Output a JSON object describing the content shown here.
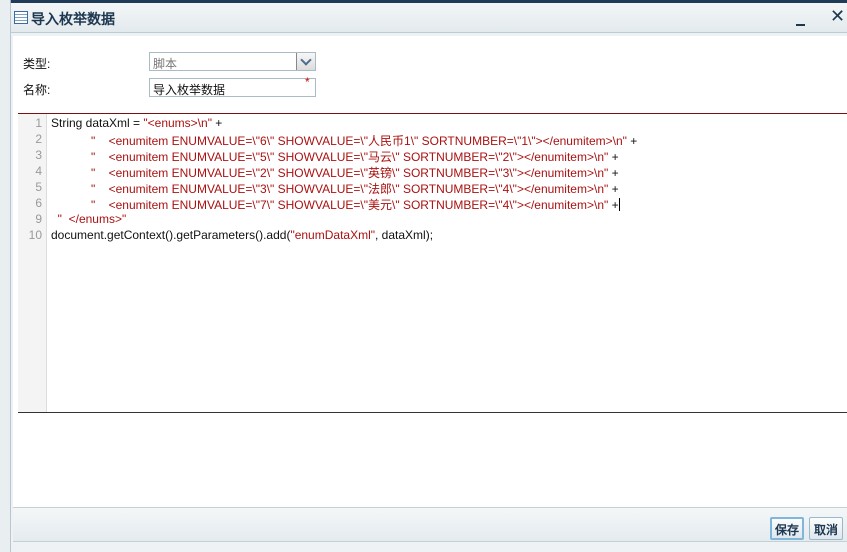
{
  "dialog": {
    "title": "导入枚举数据",
    "minimize_label": "_",
    "close_label": "✕"
  },
  "form": {
    "type_label": "类型:",
    "type_value": "脚本",
    "name_label": "名称:",
    "name_value": "导入枚举数据",
    "required_mark": "*"
  },
  "editor": {
    "line_numbers": [
      "1",
      "2",
      "3",
      "4",
      "5",
      "6",
      "9",
      "10"
    ],
    "lines": [
      [
        {
          "t": "String dataXml = ",
          "c": "p"
        },
        {
          "t": "\"<enums>\\n\"",
          "c": "s"
        },
        {
          "t": " +",
          "c": "p"
        }
      ],
      [
        {
          "t": "            \"    <enumitem ENUMVALUE=\\\"6\\\" SHOWVALUE=\\\"人民币1\\\" SORTNUMBER=\\\"1\\\"></enumitem>\\n\"",
          "c": "s"
        },
        {
          "t": " +",
          "c": "p"
        }
      ],
      [
        {
          "t": "            \"    <enumitem ENUMVALUE=\\\"5\\\" SHOWVALUE=\\\"马云\\\" SORTNUMBER=\\\"2\\\"></enumitem>\\n\"",
          "c": "s"
        },
        {
          "t": " +",
          "c": "p"
        }
      ],
      [
        {
          "t": "            \"    <enumitem ENUMVALUE=\\\"2\\\" SHOWVALUE=\\\"英镑\\\" SORTNUMBER=\\\"3\\\"></enumitem>\\n\"",
          "c": "s"
        },
        {
          "t": " +",
          "c": "p"
        }
      ],
      [
        {
          "t": "            \"    <enumitem ENUMVALUE=\\\"3\\\" SHOWVALUE=\\\"法郎\\\" SORTNUMBER=\\\"4\\\"></enumitem>\\n\"",
          "c": "s"
        },
        {
          "t": " +",
          "c": "p"
        }
      ],
      [
        {
          "t": "            \"    <enumitem ENUMVALUE=\\\"7\\\" SHOWVALUE=\\\"美元\\\" SORTNUMBER=\\\"4\\\"></enumitem>\\n\"",
          "c": "s"
        },
        {
          "t": " +",
          "c": "p"
        }
      ],
      [
        {
          "t": "  \"  </enums>\"",
          "c": "s"
        }
      ],
      [
        {
          "t": "document.getContext().getParameters().add(",
          "c": "p"
        },
        {
          "t": "\"enumDataXml\"",
          "c": "s"
        },
        {
          "t": ", dataXml);",
          "c": "p"
        }
      ]
    ]
  },
  "footer": {
    "save_label": "保存",
    "cancel_label": "取消"
  }
}
